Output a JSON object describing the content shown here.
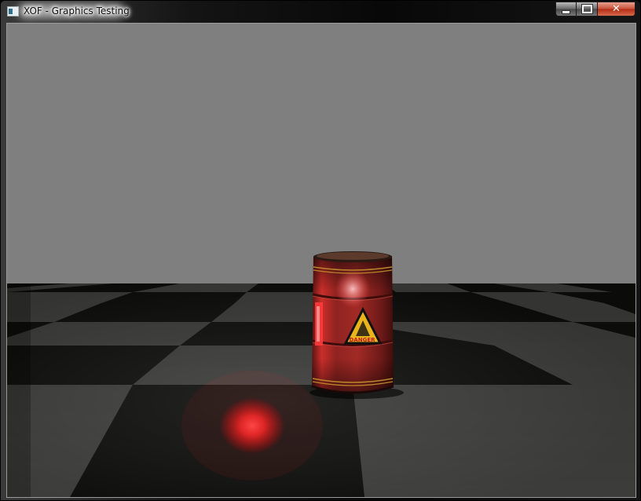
{
  "window": {
    "title": "XOF - Graphics Testing",
    "icon": "app-window-icon",
    "controls": {
      "minimize_icon": "minimize-icon",
      "maximize_icon": "maximize-icon",
      "close_label": "✕"
    }
  },
  "scene": {
    "sky_color": "#7f7f7f",
    "floor_dark_color": "#0d0d0b",
    "floor_light_color": "#3c3c3a",
    "light_color": "#ff3a3a",
    "barrel_color": "#8a1d1b",
    "barrel_label": "DANGER"
  }
}
